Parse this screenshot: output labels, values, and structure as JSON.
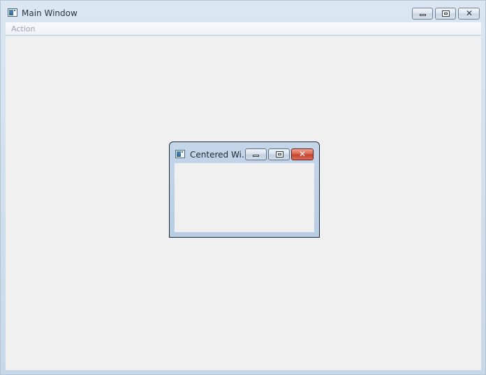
{
  "main_window": {
    "title": "Main Window",
    "icon": "app-window-icon",
    "caption_buttons": {
      "minimize": "minimize-icon",
      "maximize": "maximize-icon",
      "close": "close-icon"
    },
    "menu": {
      "items": [
        {
          "label": "Action",
          "enabled": false
        }
      ]
    }
  },
  "child_window": {
    "title": "Centered Wi...",
    "icon": "app-window-icon",
    "caption_buttons": {
      "minimize": "minimize-icon",
      "maximize": "maximize-icon",
      "close": "close-icon"
    }
  },
  "colors": {
    "close_button_active": "#c2402b",
    "disabled_text": "#a0a6ad",
    "client_background": "#f0f0f0"
  }
}
